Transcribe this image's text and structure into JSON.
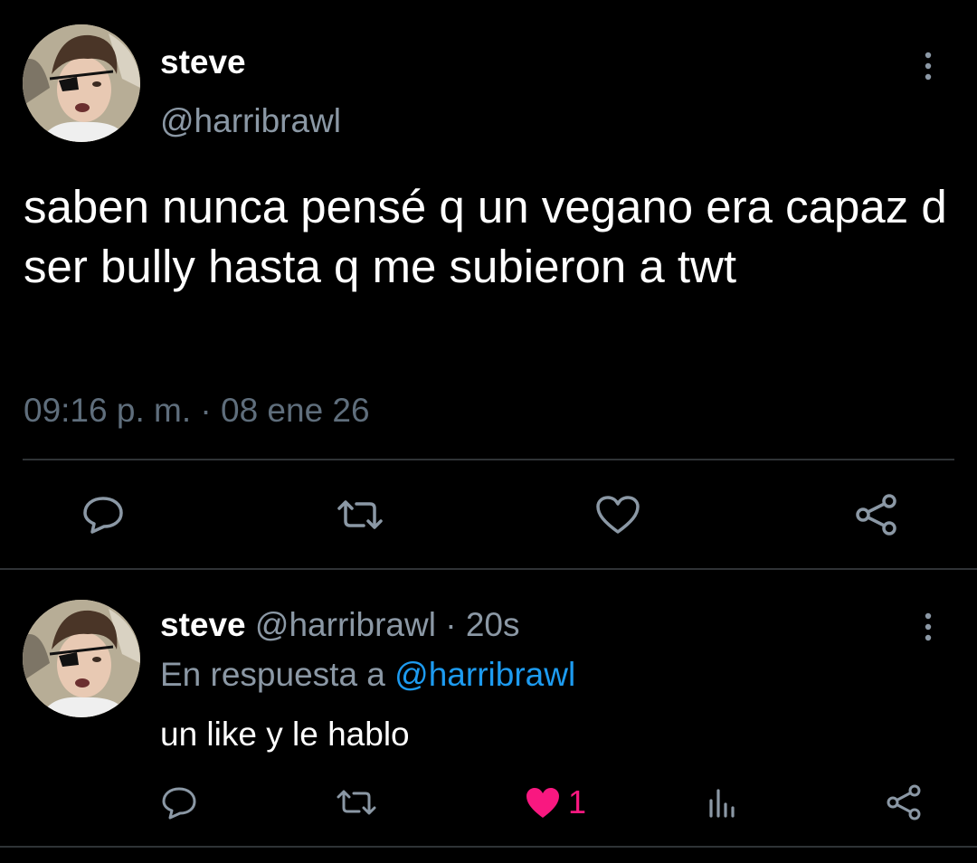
{
  "main_tweet": {
    "author_name": "steve",
    "author_handle": "@harribrawl",
    "text": "saben nunca pensé q un vegano era capaz d ser bully hasta q me subieron a twt",
    "timestamp": "09:16 p. m. · 08 ene 26",
    "icons": {
      "more": "more-vertical-icon",
      "reply": "reply-icon",
      "retweet": "retweet-icon",
      "like": "heart-outline-icon",
      "share": "share-icon"
    }
  },
  "reply_tweet": {
    "author_name": "steve",
    "author_handle": "@harribrawl",
    "separator": " · ",
    "time_ago": "20s",
    "reply_context_prefix": "En respuesta a ",
    "reply_context_mention": "@harribrawl",
    "text": "un like y le hablo",
    "like_count": "1",
    "liked": true,
    "icons": {
      "more": "more-vertical-icon",
      "reply": "reply-icon",
      "retweet": "retweet-icon",
      "like": "heart-filled-icon",
      "stats": "analytics-icon",
      "share": "share-icon"
    }
  },
  "colors": {
    "background": "#000000",
    "text_primary": "#ffffff",
    "text_secondary": "#8b98a5",
    "icon": "#8b98a5",
    "link": "#1d9bf0",
    "like": "#f91880",
    "divider": "#2f3336"
  }
}
